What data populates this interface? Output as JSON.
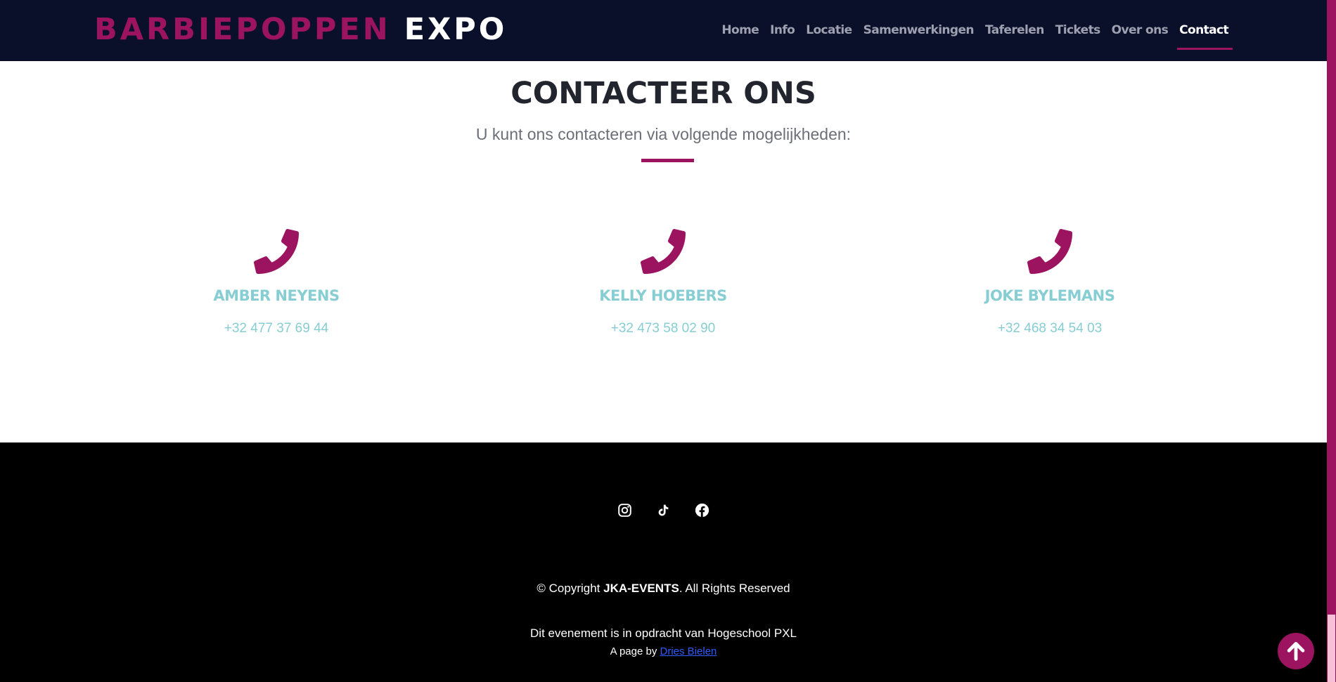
{
  "header": {
    "brand_part1": "BARBIEPOPPEN",
    "brand_part2": "EXPO",
    "nav": [
      {
        "label": "Home"
      },
      {
        "label": "Info"
      },
      {
        "label": "Locatie"
      },
      {
        "label": "Samenwerkingen"
      },
      {
        "label": "Taferelen"
      },
      {
        "label": "Tickets"
      },
      {
        "label": "Over ons"
      },
      {
        "label": "Contact",
        "active": true
      }
    ]
  },
  "contact": {
    "title": "CONTACTEER ONS",
    "subtitle": "U kunt ons contacteren via volgende mogelijkheden:",
    "people": [
      {
        "name": "AMBER NEYENS",
        "phone": "+32 477 37 69 44",
        "icon": "phone-icon"
      },
      {
        "name": "KELLY HOEBERS",
        "phone": "+32 473 58 02 90",
        "icon": "phone-icon"
      },
      {
        "name": "JOKE BYLEMANS",
        "phone": "+32 468 34 54 03",
        "icon": "phone-icon"
      }
    ]
  },
  "footer": {
    "social": [
      "instagram-icon",
      "tiktok-icon",
      "facebook-icon"
    ],
    "copyright_prefix": "© Copyright ",
    "copyright_company": "JKA-EVENTS",
    "copyright_suffix": ". All Rights Reserved",
    "commission": "Dit evenement is in opdracht van Hogeschool PXL",
    "credit_prefix": "A page by ",
    "credit_link": "Dries Bielen"
  },
  "back_to_top": {
    "icon": "arrow-up-icon"
  },
  "colors": {
    "accent": "#9c1460",
    "navbar_bg": "#0b102a",
    "contact_text": "#86ced3",
    "footer_bg": "#000000",
    "link": "#2f5bff"
  }
}
